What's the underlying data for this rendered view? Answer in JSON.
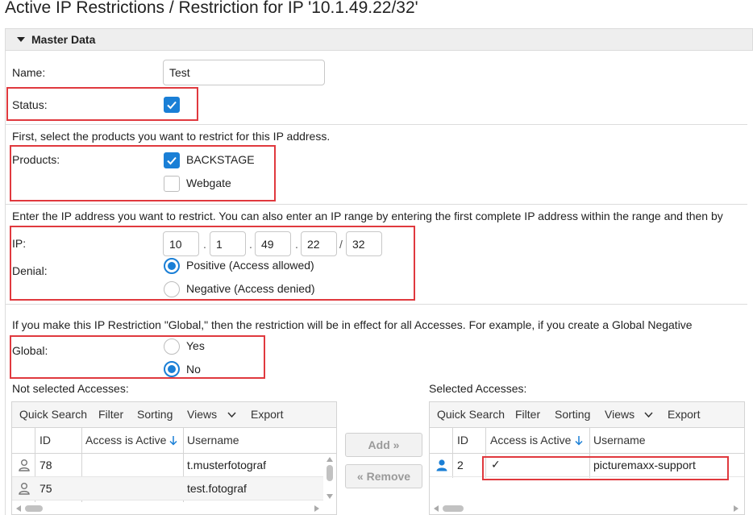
{
  "page": {
    "title": "Active IP Restrictions / Restriction for IP '10.1.49.22/32'"
  },
  "section": {
    "label": "Master Data"
  },
  "form": {
    "name_label": "Name:",
    "name_value": "Test",
    "status_label": "Status:",
    "status_checked": true,
    "products_hint": "First, select the products you want to restrict for this IP address.",
    "products_label": "Products:",
    "products": [
      {
        "label": "BACKSTAGE",
        "checked": true
      },
      {
        "label": "Webgate",
        "checked": false
      }
    ],
    "ip_hint": "Enter the IP address you want to restrict. You can also enter an IP range by entering the first complete IP address within the range and then by",
    "ip_label": "IP:",
    "ip_octets": [
      "10",
      "1",
      "49",
      "22"
    ],
    "ip_dot": ".",
    "ip_slash": "/",
    "ip_mask": "32",
    "denial_label": "Denial:",
    "denial_options": [
      {
        "label": "Positive (Access allowed)",
        "selected": true
      },
      {
        "label": "Negative (Access denied)",
        "selected": false
      }
    ],
    "global_hint": "If you make this IP Restriction \"Global,\" then the restriction will be in effect for all Accesses. For example, if you create a Global Negative",
    "global_label": "Global:",
    "global_options": [
      {
        "label": "Yes",
        "selected": false
      },
      {
        "label": "No",
        "selected": true
      }
    ]
  },
  "not_selected": {
    "label": "Not selected Accesses:",
    "toolbar": {
      "quick_search": "Quick Search",
      "filter": "Filter",
      "sorting": "Sorting",
      "views": "Views",
      "export": "Export"
    },
    "columns": [
      "ID",
      "Access is Active",
      "Username"
    ],
    "rows": [
      {
        "id": "78",
        "active": "",
        "username": "t.musterfotograf"
      },
      {
        "id": "75",
        "active": "",
        "username": "test.fotograf"
      }
    ]
  },
  "buttons": {
    "add": "Add »",
    "remove": "« Remove"
  },
  "selected": {
    "label": "Selected Accesses:",
    "toolbar": {
      "quick_search": "Quick Search",
      "filter": "Filter",
      "sorting": "Sorting",
      "views": "Views",
      "export": "Export"
    },
    "columns": [
      "ID",
      "Access is Active",
      "Username"
    ],
    "rows": [
      {
        "id": "2",
        "active": "✓",
        "username": "picturemaxx-support"
      }
    ]
  },
  "colors": {
    "accent": "#1a7fd6",
    "highlight": "#e0393e"
  },
  "icons": {
    "section_toggle": "caret-down-icon",
    "sort": "sort-down-arrow-icon",
    "user_inactive": "user-outline-icon",
    "user_active": "user-filled-icon"
  }
}
